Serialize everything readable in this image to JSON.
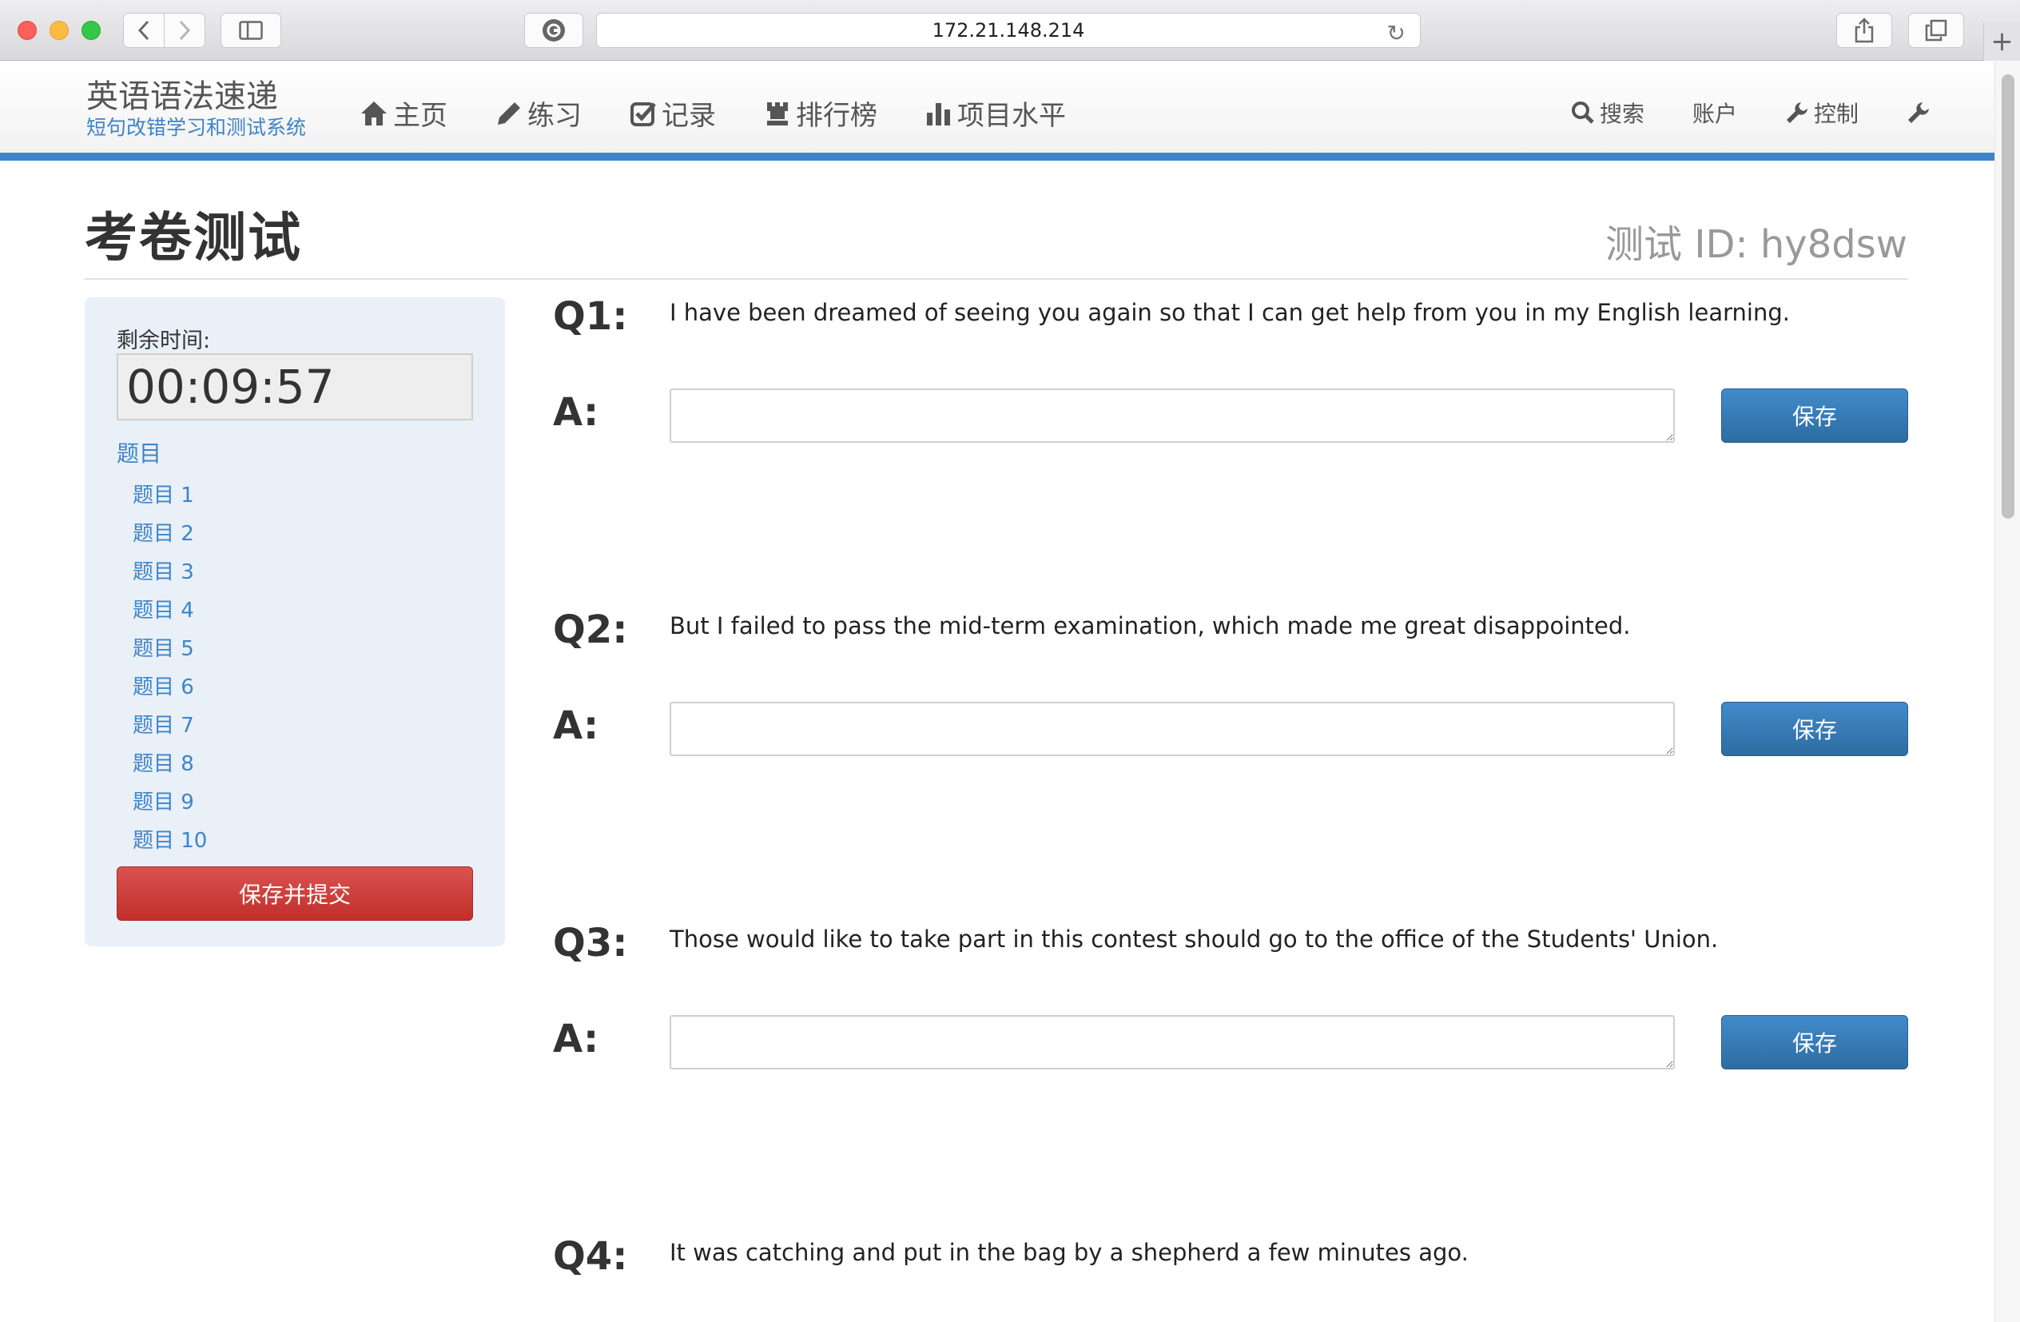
{
  "browser": {
    "url": "172.21.148.214"
  },
  "site": {
    "brand_title": "英语语法速递",
    "brand_subtitle": "短句改错学习和测试系统",
    "nav": [
      {
        "label": "主页",
        "icon": "home-icon"
      },
      {
        "label": "练习",
        "icon": "pencil-icon"
      },
      {
        "label": "记录",
        "icon": "check-square-icon"
      },
      {
        "label": "排行榜",
        "icon": "rook-icon"
      },
      {
        "label": "项目水平",
        "icon": "bar-chart-icon"
      }
    ],
    "nav_right": {
      "search": "搜索",
      "account": "账户",
      "control": "控制"
    }
  },
  "page": {
    "title": "考卷测试",
    "test_id": "测试 ID: hy8dsw"
  },
  "sidebar": {
    "timer_label": "剩余时间:",
    "timer_value": "00:09:57",
    "toc_heading": "题目",
    "toc": [
      "题目 1",
      "题目 2",
      "题目 3",
      "题目 4",
      "题目 5",
      "题目 6",
      "题目 7",
      "题目 8",
      "题目 9",
      "题目 10"
    ],
    "submit_label": "保存并提交"
  },
  "questions": [
    {
      "num": "Q1:",
      "text": "I have been dreamed of seeing you again so that I can get help from you in my English learning.",
      "answer_label": "A:",
      "answer_value": "",
      "save_label": "保存"
    },
    {
      "num": "Q2:",
      "text": "But I failed to pass the mid-term examination, which made me great disappointed.",
      "answer_label": "A:",
      "answer_value": "",
      "save_label": "保存"
    },
    {
      "num": "Q3:",
      "text": "Those would like to take part in this contest should go to the office of the Students' Union.",
      "answer_label": "A:",
      "answer_value": "",
      "save_label": "保存"
    },
    {
      "num": "Q4:",
      "text": "It was catching and put in the bag by a shepherd a few minutes ago."
    }
  ],
  "colors": {
    "accent": "#3e84c8",
    "primary_button": "#337ab7",
    "danger_button": "#c9302c",
    "sidebar_bg": "#e9f0f8"
  }
}
